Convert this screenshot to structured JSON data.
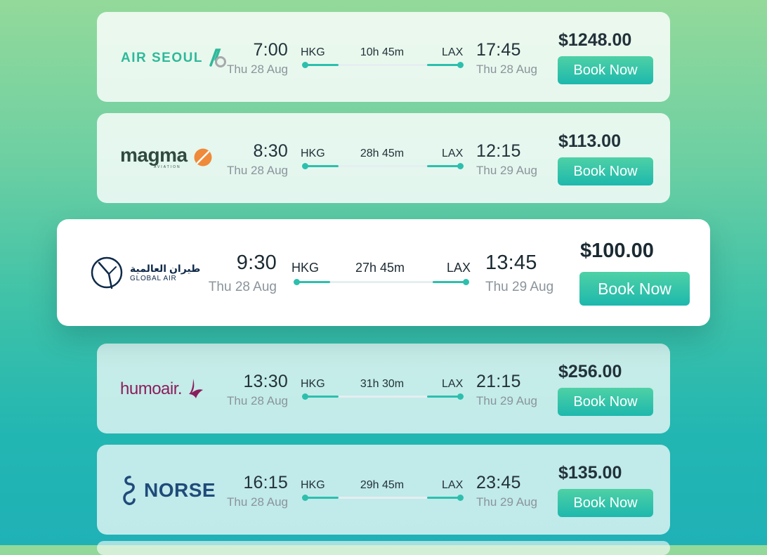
{
  "flights": [
    {
      "airline": "AIR SEOUL",
      "depart_time": "7:00",
      "depart_date": "Thu 28 Aug",
      "origin": "HKG",
      "duration": "10h 45m",
      "destination": "LAX",
      "arrive_time": "17:45",
      "arrive_date": "Thu 28 Aug",
      "price": "$1248.00",
      "book_label": "Book Now"
    },
    {
      "airline": "magma",
      "airline_sub": "AVIATION",
      "depart_time": "8:30",
      "depart_date": "Thu 28 Aug",
      "origin": "HKG",
      "duration": "28h 45m",
      "destination": "LAX",
      "arrive_time": "12:15",
      "arrive_date": "Thu 29 Aug",
      "price": "$113.00",
      "book_label": "Book Now"
    },
    {
      "airline": "GLOBAL AIR",
      "airline_arabic": "طيران العالمية",
      "depart_time": "9:30",
      "depart_date": "Thu 28 Aug",
      "origin": "HKG",
      "duration": "27h 45m",
      "destination": "LAX",
      "arrive_time": "13:45",
      "arrive_date": "Thu 29 Aug",
      "price": "$100.00",
      "book_label": "Book Now"
    },
    {
      "airline": "humoair.",
      "depart_time": "13:30",
      "depart_date": "Thu 28 Aug",
      "origin": "HKG",
      "duration": "31h 30m",
      "destination": "LAX",
      "arrive_time": "21:15",
      "arrive_date": "Thu 29 Aug",
      "price": "$256.00",
      "book_label": "Book Now"
    },
    {
      "airline": "NORSE",
      "depart_time": "16:15",
      "depart_date": "Thu 28 Aug",
      "origin": "HKG",
      "duration": "29h 45m",
      "destination": "LAX",
      "arrive_time": "23:45",
      "arrive_date": "Thu 29 Aug",
      "price": "$135.00",
      "book_label": "Book Now"
    }
  ],
  "colors": {
    "accent": "#2dbfae",
    "air_seoul": "#2db99a",
    "magma_text": "#2f4a3e",
    "magma_orange": "#ef8a3a",
    "global_air": "#0f2a4a",
    "humo": "#8b1e5c",
    "norse": "#1f4b7a"
  }
}
